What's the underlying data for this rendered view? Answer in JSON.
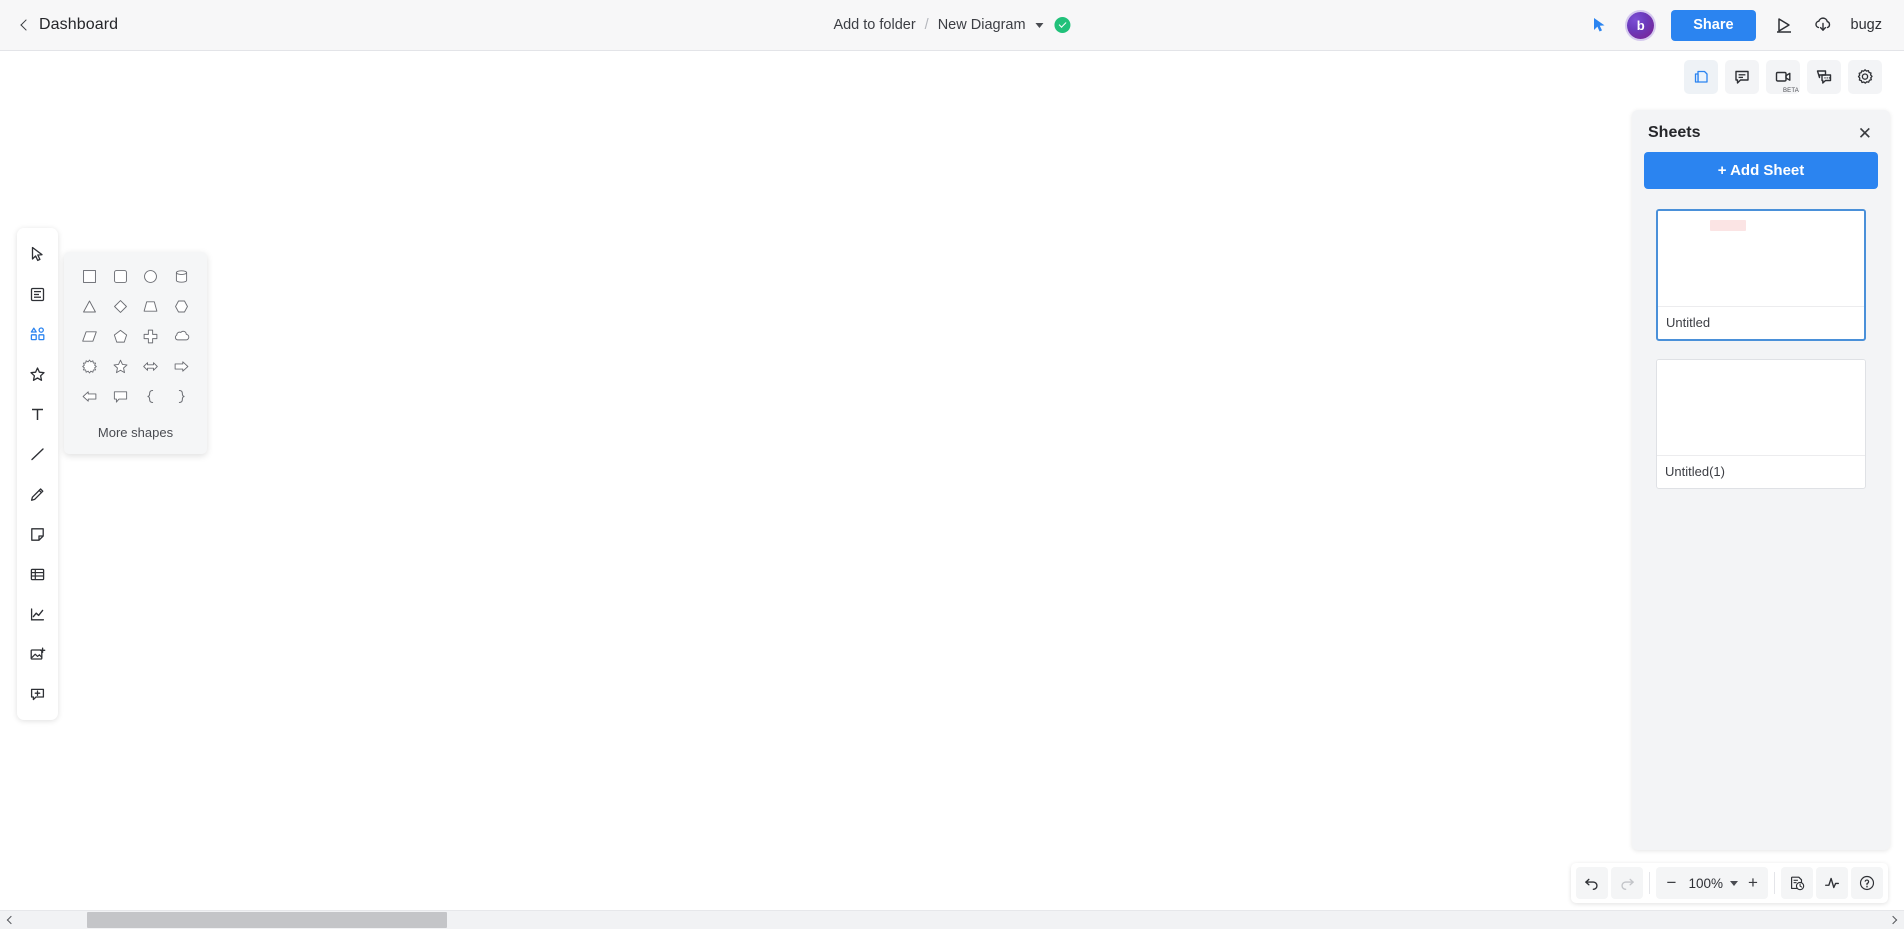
{
  "header": {
    "back_label": "Dashboard",
    "back_icon": "chevron-left-icon",
    "breadcrumb": {
      "folder_label": "Add to folder",
      "separator": "/",
      "document_title": "New Diagram",
      "dropdown_icon": "caret-down-icon",
      "saved_icon": "check-circle-icon"
    },
    "right": {
      "cursor_icon": "cursor-pointer-icon",
      "avatar_initial": "b",
      "share_label": "Share",
      "present_icon": "present-play-icon",
      "download_icon": "cloud-download-icon",
      "username": "bugz"
    }
  },
  "panel_tabs": [
    {
      "name": "sheets-icon",
      "label": "Sheets",
      "active": true,
      "badge": ""
    },
    {
      "name": "comment-icon",
      "label": "Comments",
      "active": false,
      "badge": ""
    },
    {
      "name": "video-camera-icon",
      "label": "Video",
      "active": false,
      "badge": "BETA"
    },
    {
      "name": "chat-icon",
      "label": "Chat",
      "active": false,
      "badge": ""
    },
    {
      "name": "gear-icon",
      "label": "Settings",
      "active": false,
      "badge": ""
    }
  ],
  "sheets_panel": {
    "title": "Sheets",
    "close_icon": "close-icon",
    "add_button_label": "+ Add Sheet",
    "sheets": [
      {
        "name": "Untitled",
        "selected": true,
        "has_content": true
      },
      {
        "name": "Untitled(1)",
        "selected": false,
        "has_content": false
      }
    ]
  },
  "left_toolbar": [
    {
      "icon": "cursor-select-icon",
      "label": "Select",
      "active": false
    },
    {
      "icon": "template-icon",
      "label": "Templates",
      "active": false
    },
    {
      "icon": "shapes-icon",
      "label": "Shapes",
      "active": true
    },
    {
      "icon": "star-icon",
      "label": "Favorites",
      "active": false
    },
    {
      "icon": "text-icon",
      "label": "Text",
      "active": false
    },
    {
      "icon": "line-icon",
      "label": "Line",
      "active": false
    },
    {
      "icon": "pencil-icon",
      "label": "Draw",
      "active": false
    },
    {
      "icon": "sticky-note-icon",
      "label": "Sticky Note",
      "active": false
    },
    {
      "icon": "table-icon",
      "label": "Table",
      "active": false
    },
    {
      "icon": "chart-icon",
      "label": "Chart",
      "active": false
    },
    {
      "icon": "image-icon",
      "label": "Image",
      "active": false
    },
    {
      "icon": "add-comment-icon",
      "label": "Comment",
      "active": false
    }
  ],
  "shapes_flyout": {
    "more_label": "More shapes",
    "shapes": [
      {
        "icon": "square-shape",
        "label": "Square"
      },
      {
        "icon": "rounded-square-shape",
        "label": "Rounded Square"
      },
      {
        "icon": "circle-shape",
        "label": "Circle"
      },
      {
        "icon": "cylinder-shape",
        "label": "Cylinder"
      },
      {
        "icon": "triangle-shape",
        "label": "Triangle"
      },
      {
        "icon": "diamond-shape",
        "label": "Diamond"
      },
      {
        "icon": "trapezoid-shape",
        "label": "Trapezoid"
      },
      {
        "icon": "hexagon-shape",
        "label": "Hexagon"
      },
      {
        "icon": "parallelogram-shape",
        "label": "Parallelogram"
      },
      {
        "icon": "pentagon-shape",
        "label": "Pentagon"
      },
      {
        "icon": "cross-shape",
        "label": "Cross"
      },
      {
        "icon": "cloud-shape",
        "label": "Cloud"
      },
      {
        "icon": "starburst-shape",
        "label": "Starburst"
      },
      {
        "icon": "star-shape",
        "label": "Star"
      },
      {
        "icon": "double-arrow-shape",
        "label": "Double Arrow"
      },
      {
        "icon": "right-arrow-shape",
        "label": "Right Arrow"
      },
      {
        "icon": "left-arrow-shape",
        "label": "Left Arrow"
      },
      {
        "icon": "speech-bubble-shape",
        "label": "Speech Bubble"
      },
      {
        "icon": "left-brace-shape",
        "label": "{"
      },
      {
        "icon": "right-brace-shape",
        "label": "}"
      }
    ]
  },
  "bottom_bar": {
    "undo_icon": "undo-icon",
    "redo_icon": "redo-icon",
    "zoom_out": "−",
    "zoom_value": "100%",
    "zoom_dropdown_icon": "caret-down-icon",
    "zoom_in": "+",
    "history_icon": "version-history-icon",
    "activity_icon": "activity-pulse-icon",
    "help_icon": "help-circle-icon"
  },
  "scrollbar": {
    "left_icon": "chevron-left-icon",
    "right_icon": "chevron-right-icon"
  },
  "colors": {
    "accent_blue": "#2b84f0",
    "active_blue": "#4a90d9",
    "saved_green": "#21c17a",
    "avatar_purple": "#6b3bbd",
    "thumb_pink": "#fbe4e4"
  }
}
